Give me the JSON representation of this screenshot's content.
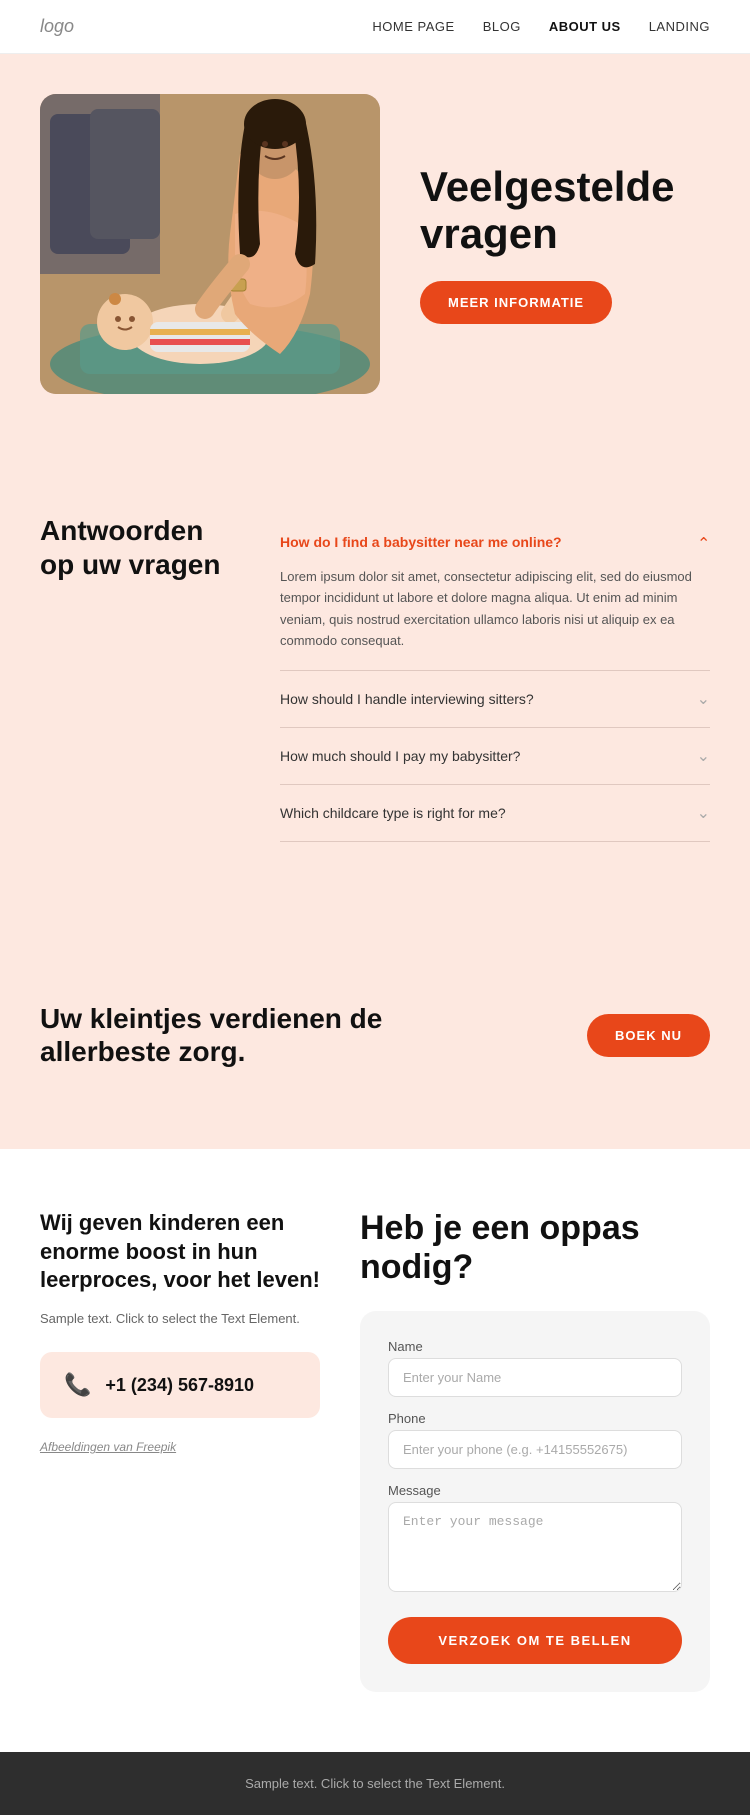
{
  "nav": {
    "logo": "logo",
    "links": [
      {
        "label": "HOME PAGE",
        "id": "home",
        "active": false
      },
      {
        "label": "BLOG",
        "id": "blog",
        "active": false
      },
      {
        "label": "ABOUT US",
        "id": "about",
        "active": true
      },
      {
        "label": "LANDING",
        "id": "landing",
        "active": false
      }
    ]
  },
  "hero": {
    "title": "Veelgestelde vragen",
    "cta_button": "MEER INFORMATIE"
  },
  "faq": {
    "section_title": "Antwoorden op uw vragen",
    "items": [
      {
        "question": "How do I find a babysitter near me online?",
        "open": true,
        "answer": "Lorem ipsum dolor sit amet, consectetur adipiscing elit, sed do eiusmod tempor incididunt ut labore et dolore magna aliqua. Ut enim ad minim veniam, quis nostrud exercitation ullamco laboris nisi ut aliquip ex ea commodo consequat."
      },
      {
        "question": "How should I handle interviewing sitters?",
        "open": false,
        "answer": ""
      },
      {
        "question": "How much should I pay my babysitter?",
        "open": false,
        "answer": ""
      },
      {
        "question": "Which childcare type is right for me?",
        "open": false,
        "answer": ""
      }
    ]
  },
  "cta": {
    "text": "Uw kleintjes verdienen de allerbeste zorg.",
    "button": "BOEK NU"
  },
  "contact": {
    "left_title": "Wij geven kinderen een enorme boost in hun leerproces, voor het leven!",
    "left_text": "Sample text. Click to select the Text Element.",
    "phone": "+1 (234) 567-8910",
    "freepik": "Afbeeldingen van Freepik",
    "right_title": "Heb je een oppas nodig?",
    "form": {
      "name_label": "Name",
      "name_placeholder": "Enter your Name",
      "phone_label": "Phone",
      "phone_placeholder": "Enter your phone (e.g. +14155552675)",
      "message_label": "Message",
      "message_placeholder": "Enter your message",
      "submit_button": "VERZOEK OM TE BELLEN"
    }
  },
  "footer": {
    "text": "Sample text. Click to select the Text Element."
  },
  "colors": {
    "orange": "#e8471a",
    "bg_peach": "#fde8e0",
    "dark": "#2e2e2e"
  }
}
